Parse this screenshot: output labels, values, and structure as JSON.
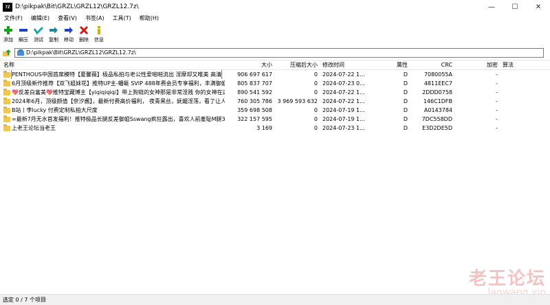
{
  "window": {
    "app_icon_text": "7Z",
    "title": "D:\\pikpak\\Bit\\GRZL\\GRZL12\\GRZL12.7z\\",
    "controls": {
      "minimize": "—",
      "maximize": "☐",
      "close": "✕"
    }
  },
  "menu": [
    "文件(F)",
    "编辑(E)",
    "查看(V)",
    "书签(A)",
    "工具(T)",
    "帮助(H)"
  ],
  "toolbar": [
    {
      "id": "add",
      "label": "添加",
      "icon": "plus-icon",
      "color": "#1aa01a"
    },
    {
      "id": "extract",
      "label": "解压",
      "icon": "minus-icon",
      "color": "#1f3fc4"
    },
    {
      "id": "test",
      "label": "测试",
      "icon": "check-icon",
      "color": "#1aa8b0"
    },
    {
      "id": "copy",
      "label": "复制",
      "icon": "copy-arrow-icon",
      "color": "#1a8a9a"
    },
    {
      "id": "move",
      "label": "移动",
      "icon": "move-arrow-icon",
      "color": "#1f3fc4"
    },
    {
      "id": "delete",
      "label": "删除",
      "icon": "delete-x-icon",
      "color": "#d01818"
    },
    {
      "id": "info",
      "label": "信息",
      "icon": "info-icon",
      "color": "#d0b000"
    }
  ],
  "address": {
    "path": "D:\\pikpak\\Bit\\GRZL\\GRZL12\\GRZL12.7z\\"
  },
  "columns": {
    "name": "名称",
    "size": "大小",
    "packed": "压缩后大小",
    "mtime": "修改时间",
    "attr": "属性",
    "crc": "CRC",
    "encrypted": "加密",
    "method": "算法"
  },
  "rows": [
    {
      "name": "PENTHOUS中国首席模特【夏馨薇】极品私拍与老公性爱啪啪流出 淫靡却又唯美 高清",
      "size": "906 697 617",
      "packed": "0",
      "mtime": "2024-07-22 1...",
      "attr": "D",
      "crc": "7080055A",
      "enc": "-",
      "focused": true
    },
    {
      "name": "6月顶级新作推荐【双飞姐妹花】推特UP主-蟠蜓 SVIP 488年费会员专享福利，丰满御姐 ...",
      "size": "805 837 707",
      "packed": "0",
      "mtime": "2024-07-23 0...",
      "attr": "D",
      "crc": "4811EEC7",
      "enc": "-"
    },
    {
      "name": "💖反差白富美💖推特宝藏博主【yiqiqiqiqi】带上狗链的女神那是非常淫贱 你的女神在这...",
      "size": "890 541 592",
      "packed": "0",
      "mtime": "2024-07-22 1...",
      "attr": "D",
      "crc": "2DDD0758",
      "enc": "-"
    },
    {
      "name": "2024年6月，顶级颜值【奈汐酱】，最新付费高价福利， 夜青黑丝，妩媚淫荡，看了让人...",
      "size": "760 305 786",
      "packed": "3 969 593 632",
      "mtime": "2024-07-22 1...",
      "attr": "D",
      "crc": "146C1DFB",
      "enc": "-"
    },
    {
      "name": "B站丨李lucky 付费定制私拍大尺度",
      "size": "359 698 508",
      "packed": "0",
      "mtime": "2024-07-19 1...",
      "attr": "D",
      "crc": "A0143784",
      "enc": "-"
    },
    {
      "name": "=最新7月无水首发福利！推特极品长腿反差御姐Sswang疯狂露出，喜欢人前羞耻M腿3P...",
      "size": "322 157 595",
      "packed": "0",
      "mtime": "2024-07-19 1...",
      "attr": "D",
      "crc": "7DC558DD",
      "enc": "-"
    },
    {
      "name": "上老王论坛当老王",
      "size": "3 169",
      "packed": "0",
      "mtime": "2024-07-23 1...",
      "attr": "D",
      "crc": "E3D2DE5D",
      "enc": "-"
    }
  ],
  "status": {
    "text": "选定 0 / 7 个项目"
  },
  "watermark": {
    "main": "老王论坛",
    "sub": "laowang.vip"
  }
}
